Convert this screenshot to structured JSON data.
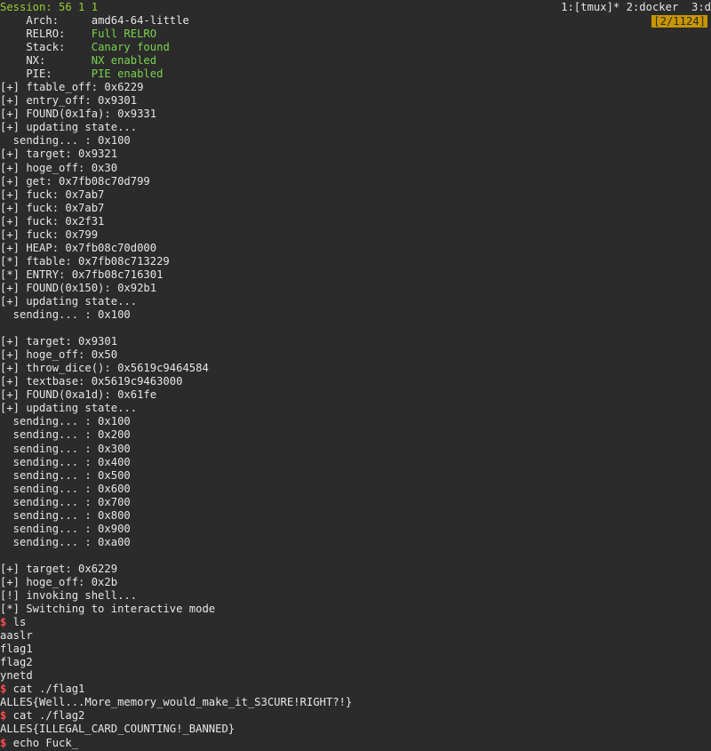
{
  "status": {
    "session": "Session: 56 1 1",
    "windows": "1:[tmux]* 2:docker  3:d",
    "scroll": "[2/1124]"
  },
  "checksec": [
    {
      "key": "    Arch:     ",
      "value": "amd64-64-little",
      "color": "#e6e6e6"
    },
    {
      "key": "    RELRO:    ",
      "value": "Full RELRO",
      "color": "#79d34f"
    },
    {
      "key": "    Stack:    ",
      "value": "Canary found",
      "color": "#79d34f"
    },
    {
      "key": "    NX:       ",
      "value": "NX enabled",
      "color": "#79d34f"
    },
    {
      "key": "    PIE:      ",
      "value": "PIE enabled",
      "color": "#79d34f"
    }
  ],
  "exploit_log": [
    "[+] ftable_off: 0x6229",
    "[+] entry_off: 0x9301",
    "[+] FOUND(0x1fa): 0x9331",
    "[+] updating state...",
    "  sending... : 0x100",
    "[+] target: 0x9321",
    "[+] hoge_off: 0x30",
    "[+] get: 0x7fb08c70d799",
    "[+] fuck: 0x7ab7",
    "[+] fuck: 0x7ab7",
    "[+] fuck: 0x2f31",
    "[+] fuck: 0x799",
    "[+] HEAP: 0x7fb08c70d000",
    "[*] ftable: 0x7fb08c713229",
    "[*] ENTRY: 0x7fb08c716301",
    "[+] FOUND(0x150): 0x92b1",
    "[+] updating state...",
    "  sending... : 0x100",
    "",
    "[+] target: 0x9301",
    "[+] hoge_off: 0x50",
    "[+] throw_dice(): 0x5619c9464584",
    "[+] textbase: 0x5619c9463000",
    "[+] FOUND(0xa1d): 0x61fe",
    "[+] updating state...",
    "  sending... : 0x100",
    "  sending... : 0x200",
    "  sending... : 0x300",
    "  sending... : 0x400",
    "  sending... : 0x500",
    "  sending... : 0x600",
    "  sending... : 0x700",
    "  sending... : 0x800",
    "  sending... : 0x900",
    "  sending... : 0xa00",
    "",
    "[+] target: 0x6229",
    "[+] hoge_off: 0x2b",
    "[!] invoking shell...",
    "[*] Switching to interactive mode"
  ],
  "shell": [
    {
      "prompt": "$",
      "text": " ls"
    },
    {
      "prompt": "",
      "text": "aaslr"
    },
    {
      "prompt": "",
      "text": "flag1"
    },
    {
      "prompt": "",
      "text": "flag2"
    },
    {
      "prompt": "",
      "text": "ynetd"
    },
    {
      "prompt": "$",
      "text": " cat ./flag1"
    },
    {
      "prompt": "",
      "text": "ALLES{Well...More_memory_would_make_it_S3CURE!RIGHT?!}"
    },
    {
      "prompt": "$",
      "text": " cat ./flag2"
    },
    {
      "prompt": "",
      "text": "ALLES{ILLEGAL_CARD_COUNTING!_BANNED}"
    },
    {
      "prompt": "$",
      "text": " echo Fuck_"
    }
  ]
}
